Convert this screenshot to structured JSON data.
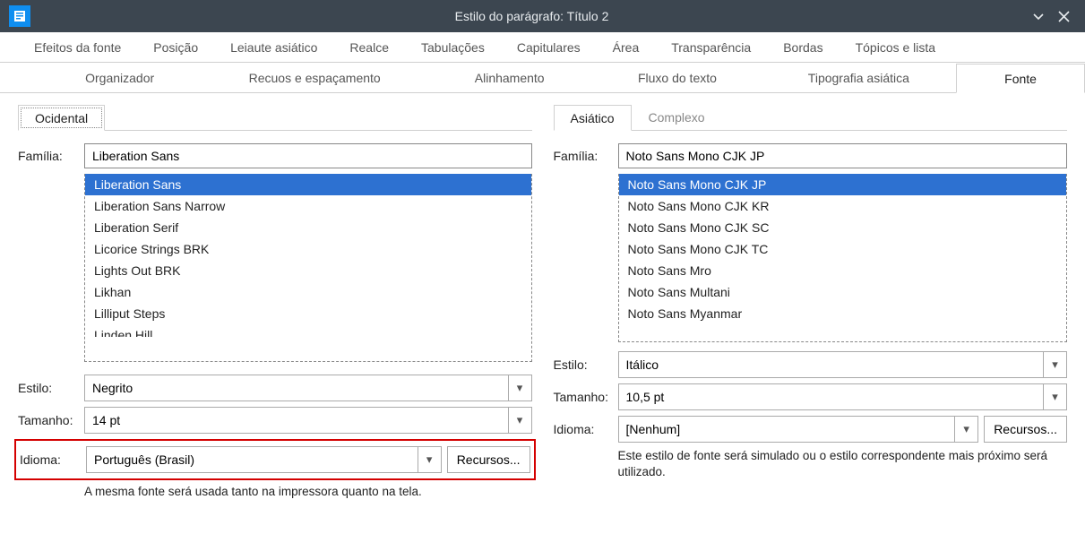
{
  "titlebar": {
    "title": "Estilo do parágrafo: Título 2"
  },
  "tabs": {
    "row1": [
      "Efeitos da fonte",
      "Posição",
      "Leiaute asiático",
      "Realce",
      "Tabulações",
      "Capitulares",
      "Área",
      "Transparência",
      "Bordas",
      "Tópicos e lista"
    ],
    "row2": [
      "Organizador",
      "Recuos e espaçamento",
      "Alinhamento",
      "Fluxo do texto",
      "Tipografia asiática",
      "Fonte"
    ],
    "active_row2_index": 5
  },
  "western": {
    "subtab_label": "Ocidental",
    "family_label": "Família:",
    "family_value": "Liberation Sans",
    "family_list": [
      "Liberation Sans",
      "Liberation Sans Narrow",
      "Liberation Serif",
      "Licorice Strings BRK",
      "Lights Out BRK",
      "Likhan",
      "Lilliput Steps",
      "Linden Hill"
    ],
    "style_label": "Estilo:",
    "style_value": "Negrito",
    "size_label": "Tamanho:",
    "size_value": "14 pt",
    "lang_label": "Idioma:",
    "lang_value": "Português (Brasil)",
    "features_label": "Recursos...",
    "hint": "A mesma fonte será usada tanto na impressora quanto na tela."
  },
  "asian": {
    "subtab_asian": "Asiático",
    "subtab_complex": "Complexo",
    "family_label": "Família:",
    "family_value": "Noto Sans Mono CJK JP",
    "family_list": [
      "Noto Sans Mono CJK JP",
      "Noto Sans Mono CJK KR",
      "Noto Sans Mono CJK SC",
      "Noto Sans Mono CJK TC",
      "Noto Sans Mro",
      "Noto Sans Multani",
      "Noto Sans Myanmar"
    ],
    "style_label": "Estilo:",
    "style_value": "Itálico",
    "size_label": "Tamanho:",
    "size_value": "10,5 pt",
    "lang_label": "Idioma:",
    "lang_value": "[Nenhum]",
    "features_label": "Recursos...",
    "hint": "Este estilo de fonte será simulado ou o estilo correspondente mais próximo será utilizado."
  }
}
